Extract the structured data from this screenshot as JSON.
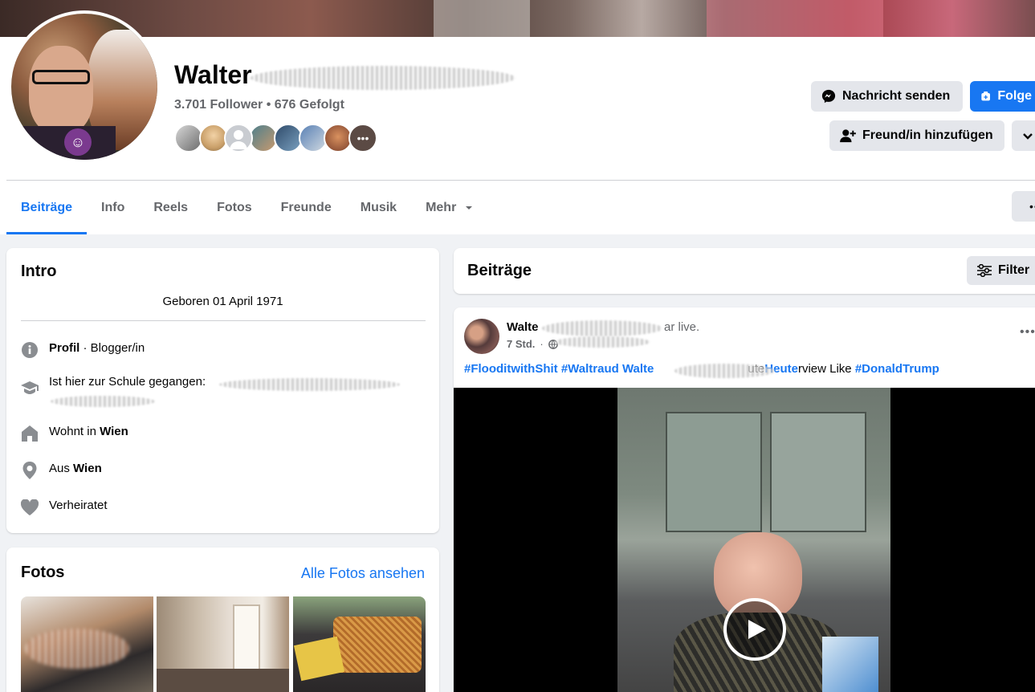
{
  "profile": {
    "name": "Walter",
    "followers_text": "3.701 Follower • 676 Gefolgt"
  },
  "actions": {
    "message_label": "Nachricht senden",
    "follow_label": "Folge",
    "add_friend_label": "Freund/in hinzufügen"
  },
  "tabs": [
    {
      "label": "Beiträge",
      "active": true
    },
    {
      "label": "Info"
    },
    {
      "label": "Reels"
    },
    {
      "label": "Fotos"
    },
    {
      "label": "Freunde"
    },
    {
      "label": "Musik"
    },
    {
      "label": "Mehr"
    }
  ],
  "intro": {
    "title": "Intro",
    "bio": "Geboren 01 April 1971",
    "items": {
      "profile_bold": "Profil",
      "profile_rest": "· Blogger/in",
      "school": "Ist hier zur Schule gegangen:",
      "lives_prefix": "Wohnt in",
      "lives_city": "Wien",
      "from_prefix": "Aus",
      "from_city": "Wien",
      "relationship": "Verheiratet"
    }
  },
  "photos": {
    "title": "Fotos",
    "all_link": "Alle Fotos ansehen"
  },
  "posts": {
    "title": "Beiträge",
    "filter_label": "Filter"
  },
  "post": {
    "author": "Walte",
    "author_suffix": "ar live.",
    "time": "7 Std.",
    "separator": "·",
    "text": {
      "tag1": "#FlooditwithShit",
      "tag2": "#Waltraud Walte",
      "mid1": "ute",
      "tag3": "Heute",
      "mid2": "rview Like ",
      "tag4": "#DonaldTrump"
    }
  },
  "icons": {
    "message": "messenger-icon",
    "follow": "follow-icon",
    "add_friend": "add-friend-icon",
    "more_menu": "chevron-down-icon",
    "info": "info-icon",
    "school": "graduation-cap-icon",
    "home": "home-icon",
    "location": "location-pin-icon",
    "heart": "heart-icon",
    "filter": "filter-icon",
    "globe": "globe-icon",
    "play": "play-icon"
  },
  "colors": {
    "accent": "#1877f2",
    "secondary_text": "#65676b",
    "background": "#f0f2f5"
  }
}
